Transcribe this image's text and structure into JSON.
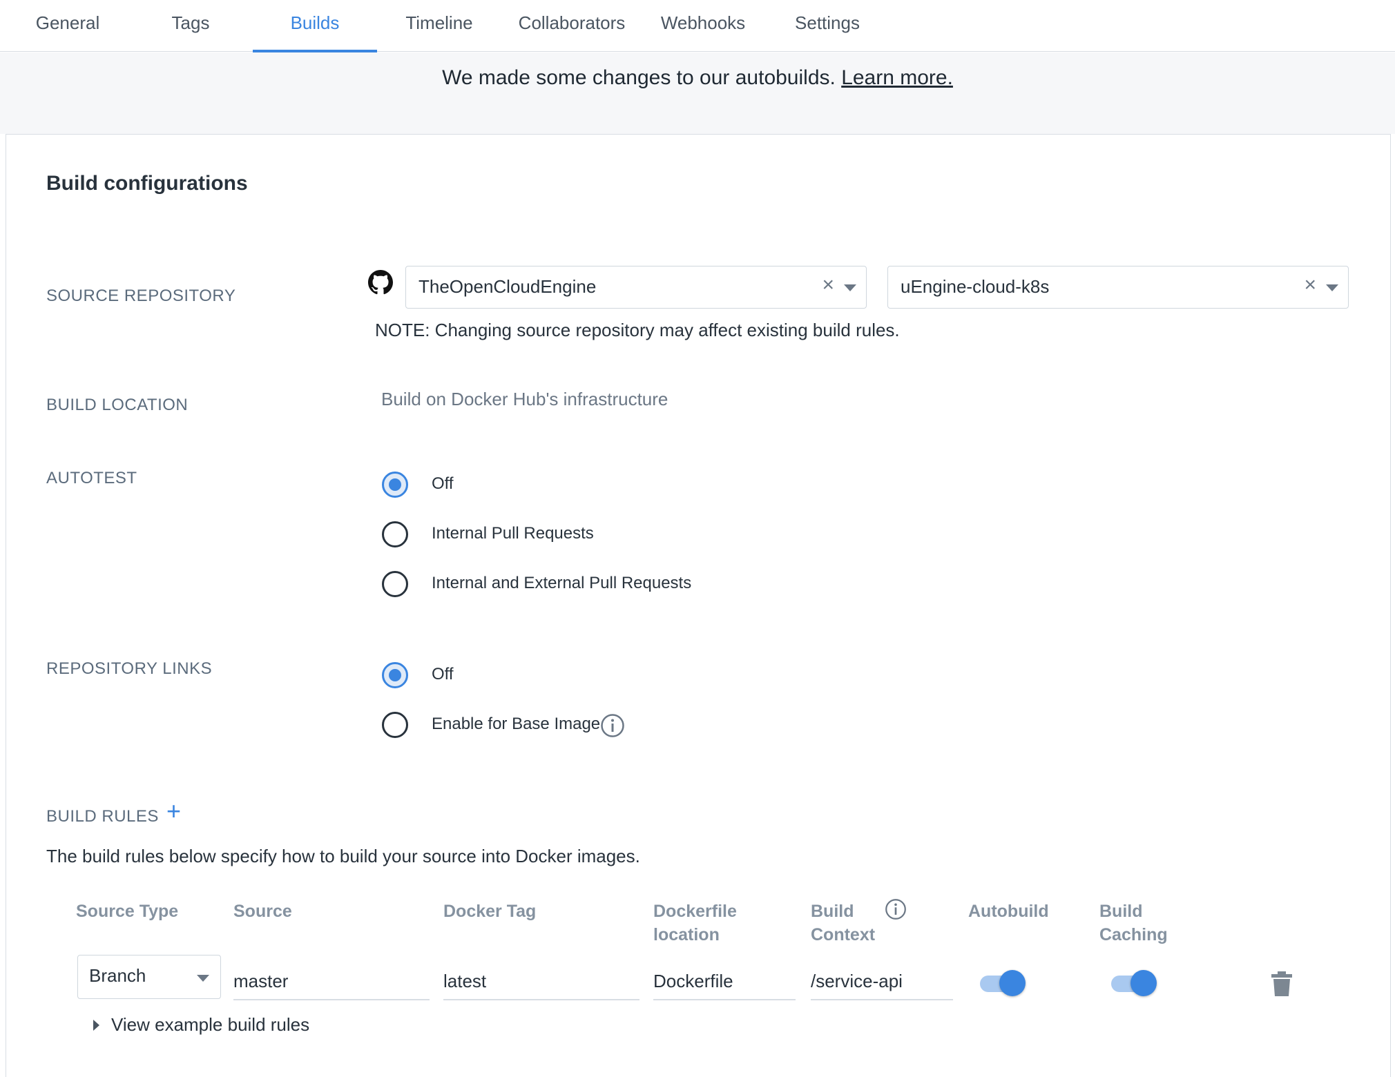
{
  "tabs": [
    {
      "label": "General"
    },
    {
      "label": "Tags"
    },
    {
      "label": "Builds",
      "active": true
    },
    {
      "label": "Timeline"
    },
    {
      "label": "Collaborators"
    },
    {
      "label": "Webhooks"
    },
    {
      "label": "Settings"
    }
  ],
  "banner": {
    "text": "We made some changes to our autobuilds.",
    "link": "Learn more."
  },
  "card": {
    "title": "Build configurations"
  },
  "source_repository": {
    "label": "SOURCE REPOSITORY",
    "organization": "TheOpenCloudEngine",
    "repository": "uEngine-cloud-k8s",
    "note": "NOTE: Changing source repository may affect existing build rules."
  },
  "build_location": {
    "label": "BUILD LOCATION",
    "value": "Build on Docker Hub's infrastructure"
  },
  "autotest": {
    "label": "AUTOTEST",
    "options": [
      {
        "label": "Off",
        "checked": true
      },
      {
        "label": "Internal Pull Requests",
        "checked": false
      },
      {
        "label": "Internal and External Pull Requests",
        "checked": false
      }
    ]
  },
  "repository_links": {
    "label": "REPOSITORY LINKS",
    "options": [
      {
        "label": "Off",
        "checked": true
      },
      {
        "label": "Enable for Base Image",
        "checked": false
      }
    ]
  },
  "build_rules": {
    "label": "BUILD RULES",
    "description": "The build rules below specify how to build your source into Docker images.",
    "headers": {
      "source_type": "Source Type",
      "source": "Source",
      "docker_tag": "Docker Tag",
      "dockerfile_location_1": "Dockerfile",
      "dockerfile_location_2": "location",
      "build_context_1": "Build",
      "build_context_2": "Context",
      "autobuild": "Autobuild",
      "build_caching_1": "Build",
      "build_caching_2": "Caching"
    },
    "rows": [
      {
        "source_type": "Branch",
        "source": "master",
        "docker_tag": "latest",
        "dockerfile_location": "Dockerfile",
        "build_context": "/service-api",
        "autobuild": true,
        "build_caching": true
      }
    ],
    "view_examples": "View example build rules"
  },
  "colors": {
    "accent": "#3a85e0",
    "text": "#28323c",
    "muted": "#5b6b7c"
  },
  "icons": {
    "github": "github-icon",
    "clear": "close-icon",
    "caret": "caret-down-icon",
    "info": "info-icon",
    "add": "plus-icon",
    "delete": "trash-icon",
    "expand": "caret-right-icon"
  }
}
